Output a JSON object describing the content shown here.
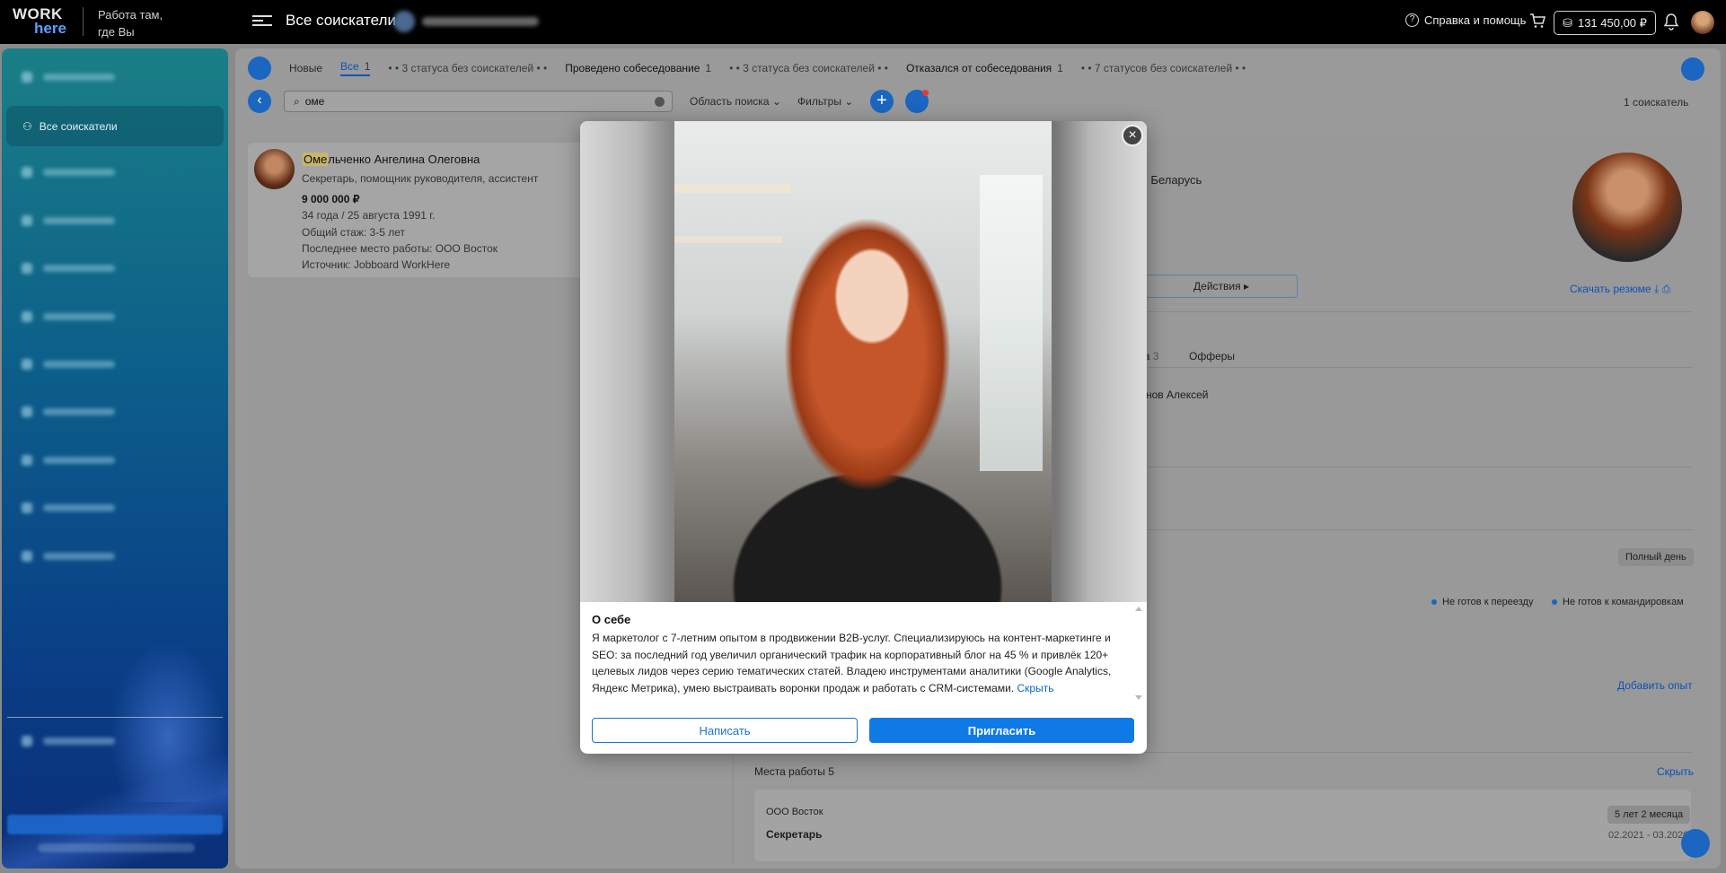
{
  "header": {
    "logo_top": "WORK",
    "logo_bottom": "here",
    "tagline": "Работа там, где Вы",
    "page_title": "Все соискатели",
    "help_label": "Справка и помощь",
    "balance": "131 450,00 ₽"
  },
  "sidebar": {
    "active_item": "Все соискатели"
  },
  "status_tabs": {
    "new_label": "Новые",
    "all_label": "Все",
    "all_count": "1",
    "empty1": "• • 3 статуса без соискателей • •",
    "interview_label": "Проведено собеседование",
    "interview_count": "1",
    "empty2": "• • 3 статуса без соискателей • •",
    "refused_label": "Отказался от собеседования",
    "refused_count": "1",
    "empty3": "• • 7 статусов без соискателей • •"
  },
  "toolbar": {
    "search_value": "оме",
    "scope_label": "Область поиска",
    "filters_label": "Фильтры",
    "results_count": "1 соискатель"
  },
  "candidate": {
    "name_highlight": "Оме",
    "name_rest": "льченко Ангелина Олеговна",
    "position": "Секретарь, помощник руководителя, ассистент",
    "salary": "9 000 000 ₽",
    "age_birth": "34 года / 25 августа 1991 г.",
    "experience": "Общий стаж:  3-5 лет",
    "last_job": "Последнее место работы:  ООО Восток",
    "source": "Источник:  Jobboard WorkHere"
  },
  "detail": {
    "location": "ск, Беларусь",
    "actions_label": "Действия",
    "download_label": "Скачать резюме",
    "tab_partial": "ата",
    "tab_partial_count": "3",
    "offers_label": "Офферы",
    "owner_partial": "нов Алексей",
    "schedule_chip": "Полный день",
    "relocation_tag": "Не готов к переезду",
    "trips_tag": "Не готов к командировкам",
    "add_experience": "Добавить опыт",
    "workplaces_label": "Места работы 5",
    "hide_label": "Скрыть",
    "work_company": "ООО Восток",
    "work_position": "Секретарь",
    "work_duration": "5 лет 2 месяца",
    "work_period": "02.2021 - 03.2026"
  },
  "modal": {
    "about_title": "О себе",
    "about_text": "Я маркетолог с 7-летним опытом в продвижении B2B-услуг. Специализируюсь на контент-маркетинге и SEO: за последний год увеличил органический трафик на корпоративный блог на 45 % и привлёк 120+ целевых лидов через серию тематических статей. Владею инструментами аналитики (Google Analytics, Яндекс Метрика), умею выстраивать воронки продаж и работать с CRM-системами.",
    "hide_link": "Скрыть",
    "write_label": "Написать",
    "invite_label": "Пригласить"
  },
  "colors": {
    "accent": "#0f7ae5",
    "topbar": "#000000",
    "overlay": "#8a8a8a"
  }
}
